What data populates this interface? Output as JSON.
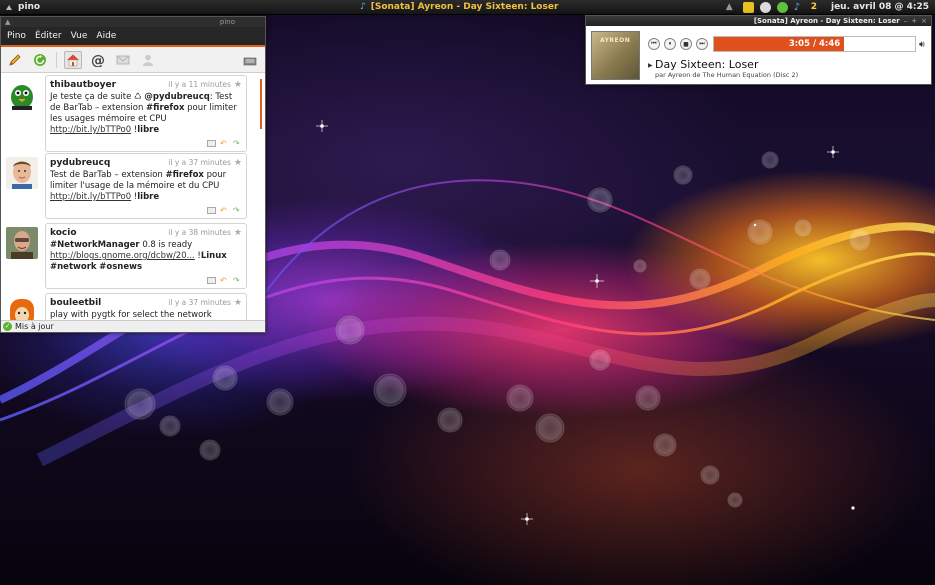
{
  "top_panel": {
    "app_name": "pino",
    "now_playing": "[Sonata] Ayreon - Day Sixteen: Loser",
    "tray_count": "2",
    "clock": "jeu. avril 08 @  4:25"
  },
  "pino": {
    "title": "pino",
    "menu": [
      "Pino",
      "Éditer",
      "Vue",
      "Aide"
    ],
    "toolbar_icons": [
      "pencil-icon",
      "refresh-icon",
      "home-icon",
      "mentions-icon",
      "direct-messages-icon",
      "user-icon",
      "compose-icon"
    ],
    "tweets": [
      {
        "user": "thibautboyer",
        "time": "il y a 11 minutes",
        "text_parts": [
          {
            "t": "Je teste ça de suite ♺ "
          },
          {
            "t": "@pydubreucq",
            "b": true
          },
          {
            "t": ": Test de BarTab – extension "
          },
          {
            "t": "#firefox",
            "b": true
          },
          {
            "t": " pour limiter les usages mémoire et CPU "
          },
          {
            "t": "http://bit.ly/bTTPo0",
            "u": true
          },
          {
            "t": " !"
          },
          {
            "t": "libre",
            "b": true
          }
        ]
      },
      {
        "user": "pydubreucq",
        "time": "il y a 37 minutes",
        "text_parts": [
          {
            "t": "Test de BarTab – extension "
          },
          {
            "t": "#firefox",
            "b": true
          },
          {
            "t": " pour limiter l'usage de la mémoire et du CPU "
          },
          {
            "t": "http://bit.ly/bTTPo0",
            "u": true
          },
          {
            "t": " !"
          },
          {
            "t": "libre",
            "b": true
          }
        ]
      },
      {
        "user": "kocio",
        "time": "il y a 38 minutes",
        "text_parts": [
          {
            "t": "#NetworkManager",
            "b": true
          },
          {
            "t": " 0.8 is ready "
          },
          {
            "t": "http://blogs.gnome.org/dcbw/20...",
            "u": true
          },
          {
            "t": " !"
          },
          {
            "t": "Linux",
            "b": true
          },
          {
            "t": " "
          },
          {
            "t": "#network",
            "b": true
          },
          {
            "t": " "
          },
          {
            "t": "#osnews",
            "b": true
          }
        ]
      },
      {
        "user": "bouleetbil",
        "time": "il y a 37 minutes",
        "text_parts": [
          {
            "t": "play with pygtk for select the network daemon"
          }
        ]
      }
    ],
    "status": "Mis à jour"
  },
  "sonata": {
    "title": "[Sonata] Ayreon - Day Sixteen: Loser",
    "album_text": "AYREON",
    "progress_text": "3:05 / 4:46",
    "progress_fraction": 0.647,
    "track_title": "Day Sixteen: Loser",
    "track_artist": "par Ayreon de The Human Equation (Disc 2)",
    "colors": {
      "progress": "#e0501c"
    }
  }
}
